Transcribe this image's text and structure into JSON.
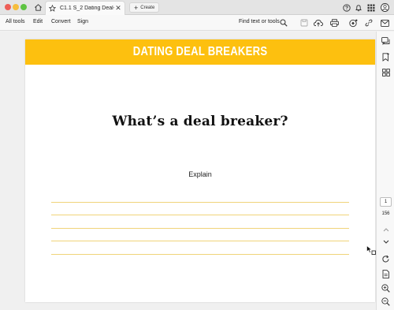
{
  "window": {
    "tab_title": "C1.1 S_2 Dating Deal-Br...",
    "create_label": "Create"
  },
  "toolbar": {
    "menu": [
      "All tools",
      "Edit",
      "Convert",
      "Sign"
    ],
    "find_text": "Find text or tools"
  },
  "document": {
    "banner_title": "DATING DEAL BREAKERS",
    "banner_color": "#fdc00f",
    "heading": "What’s a deal breaker?",
    "subheading": "Explain",
    "answer_lines": 5
  },
  "sidebar": {
    "current_page": "1",
    "total_pages": "156"
  },
  "icons": [
    "home-icon",
    "star-icon",
    "close-icon",
    "plus-icon",
    "help-icon",
    "bell-icon",
    "apps-grid-icon",
    "avatar-icon",
    "search-icon",
    "save-icon",
    "upload-icon",
    "print-icon",
    "ai-assistant-icon",
    "link-icon",
    "mail-icon",
    "comment-icon",
    "bookmark-icon",
    "thumbnails-icon",
    "chevron-up-icon",
    "chevron-down-icon",
    "rotate-icon",
    "page-tools-icon",
    "zoom-in-icon",
    "zoom-out-icon"
  ]
}
